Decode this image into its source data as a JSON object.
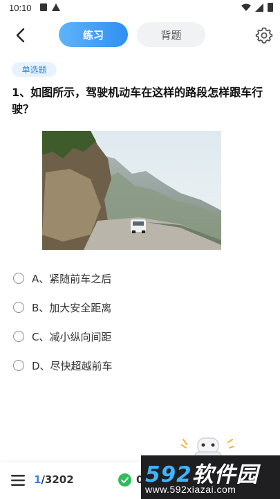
{
  "status_bar": {
    "time": "10:10",
    "icons": [
      "sim-card-icon",
      "warning-icon",
      "wifi-icon",
      "signal-icon",
      "battery-icon"
    ]
  },
  "header": {
    "back_icon": "chevron-left-icon",
    "tabs": [
      {
        "label": "练习",
        "active": true
      },
      {
        "label": "背题",
        "active": false
      }
    ],
    "settings_icon": "gear-icon",
    "accent_color": "#2f8ff3"
  },
  "question": {
    "type_label": "单选题",
    "text": "1、如图所示，驾驶机动车在这样的路段怎样跟车行驶？",
    "image_icon": "mountain-road-photo",
    "options": [
      {
        "label": "A、紧随前车之后"
      },
      {
        "label": "B、加大安全距离"
      },
      {
        "label": "C、减小纵向间距"
      },
      {
        "label": "D、尽快超越前车"
      }
    ]
  },
  "footer": {
    "menu_icon": "menu-icon",
    "current": "1",
    "total": "/3202",
    "correct_icon": "check-circle-icon",
    "correct_count": "0",
    "correct_color": "#2ebd5a"
  },
  "watermark": {
    "brand_num": "592",
    "brand_cn": "软件园",
    "url": "www.592xiazai.com"
  }
}
